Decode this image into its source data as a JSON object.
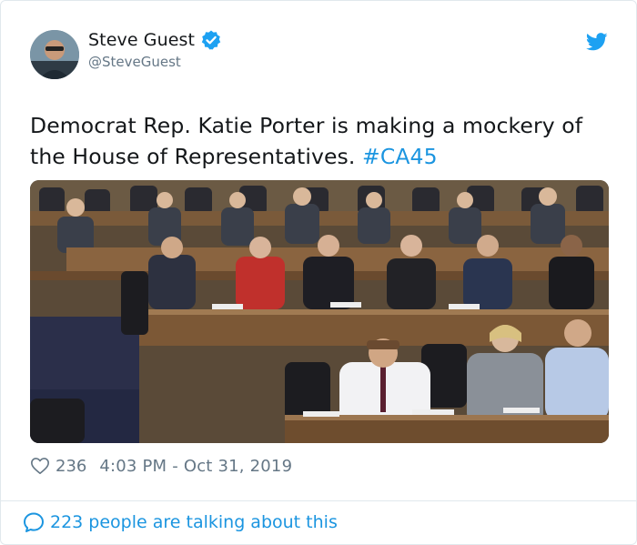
{
  "user": {
    "display_name": "Steve Guest",
    "handle": "@SteveGuest",
    "verified": true
  },
  "tweet": {
    "text_line1": "Democrat Rep. Katie Porter is making a mockery of",
    "text_line2": "the House of Representatives.",
    "hashtag": "#CA45"
  },
  "media": {
    "description_icon": "photo-image"
  },
  "meta": {
    "likes": "236",
    "timestamp": "4:03 PM - Oct 31, 2019"
  },
  "footer": {
    "talking": "223 people are talking about this"
  },
  "colors": {
    "link": "#1b95e0",
    "muted": "#657786",
    "text": "#14171a",
    "verified": "#1da1f2"
  }
}
